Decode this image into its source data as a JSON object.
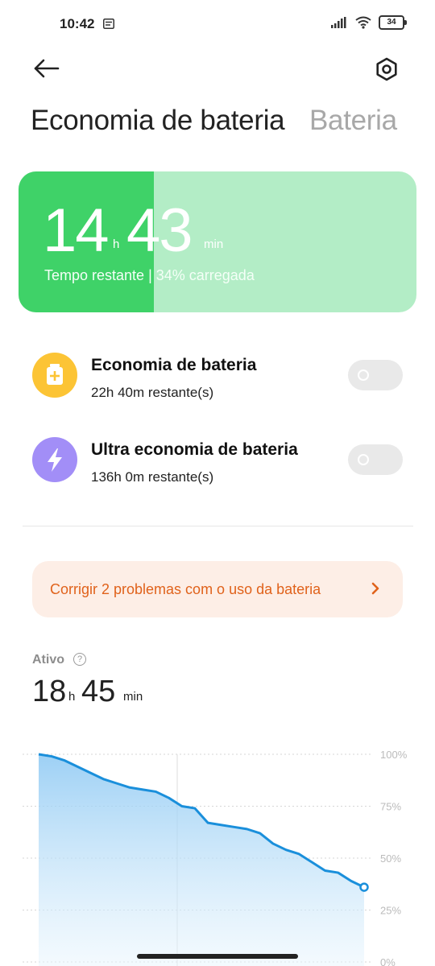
{
  "status_bar": {
    "time": "10:42",
    "battery": "34"
  },
  "header": {
    "tab_active": "Economia de bateria",
    "tab_inactive": "Bateria"
  },
  "battery_card": {
    "hours": "14",
    "hours_unit": "h",
    "minutes": "43",
    "minutes_unit": "min",
    "subtitle": "Tempo restante | 34% carregada",
    "charge_fraction": 0.34,
    "fill_color": "#3fd268",
    "track_color": "#b3edc6"
  },
  "modes": [
    {
      "title": "Economia de bateria",
      "subtitle": "22h 40m restante(s)",
      "icon": "battery-plus-icon",
      "color": "#fcc435",
      "enabled": false
    },
    {
      "title": "Ultra economia de bateria",
      "subtitle": "136h 0m restante(s)",
      "icon": "lightning-icon",
      "color": "#a28ef7",
      "enabled": false
    }
  ],
  "banner": {
    "text": "Corrigir 2 problemas com o uso da bateria",
    "color": "#e0621b"
  },
  "active": {
    "label": "Ativo",
    "hours": "18",
    "hours_unit": "h",
    "minutes": "45",
    "minutes_unit": "min"
  },
  "chart_data": {
    "type": "area",
    "title": "",
    "xlabel": "",
    "ylabel": "",
    "ylim": [
      0,
      100
    ],
    "y_ticks": [
      "100%",
      "75%",
      "50%",
      "25%",
      "0%"
    ],
    "grid": true,
    "series": [
      {
        "color": "#1a8fdb",
        "x": [
          0,
          1,
          2,
          3,
          4,
          5,
          6,
          7,
          8,
          9,
          10,
          11,
          12,
          13,
          14,
          15,
          16,
          17,
          18,
          19,
          20,
          21,
          22,
          23,
          24,
          25
        ],
        "values": [
          100,
          99,
          97,
          94,
          91,
          88,
          86,
          84,
          83,
          82,
          79,
          75,
          74,
          67,
          66,
          65,
          64,
          62,
          57,
          54,
          52,
          48,
          44,
          43,
          39,
          36
        ]
      }
    ]
  }
}
